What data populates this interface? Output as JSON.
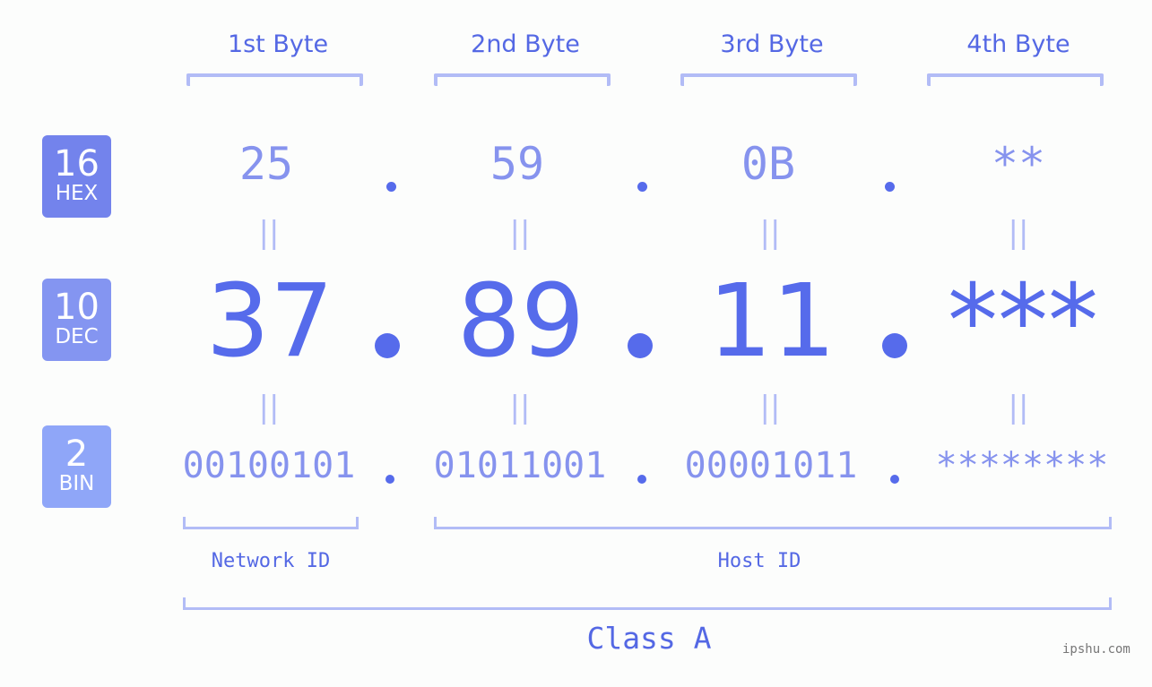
{
  "bytes": [
    {
      "title": "1st Byte",
      "hex": "25",
      "dec": "37",
      "bin": "00100101"
    },
    {
      "title": "2nd Byte",
      "hex": "59",
      "dec": "89",
      "bin": "01011001"
    },
    {
      "title": "3rd Byte",
      "hex": "0B",
      "dec": "11",
      "bin": "00001011"
    },
    {
      "title": "4th Byte",
      "hex": "**",
      "dec": "***",
      "bin": "********"
    }
  ],
  "bases": {
    "hex": {
      "num": "16",
      "label": "HEX",
      "color": "#7383ec"
    },
    "dec": {
      "num": "10",
      "label": "DEC",
      "color": "#8495f1"
    },
    "bin": {
      "num": "2",
      "label": "BIN",
      "color": "#8fa6f8"
    }
  },
  "equals_sign": "||",
  "network_label": "Network ID",
  "host_label": "Host ID",
  "class_label": "Class A",
  "watermark": "ipshu.com",
  "colors": {
    "accent": "#566beb",
    "light": "#8693ee",
    "bracket": "#b2bcf6"
  }
}
